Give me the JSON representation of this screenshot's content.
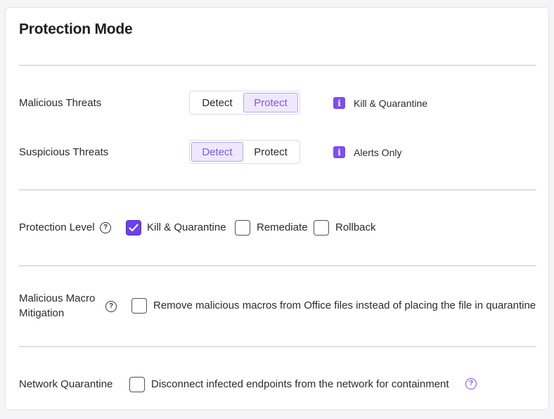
{
  "title": "Protection Mode",
  "threats": {
    "malicious": {
      "label": "Malicious Threats",
      "options": [
        "Detect",
        "Protect"
      ],
      "selected": "Protect",
      "info": "Kill & Quarantine"
    },
    "suspicious": {
      "label": "Suspicious Threats",
      "options": [
        "Detect",
        "Protect"
      ],
      "selected": "Detect",
      "info": "Alerts Only"
    }
  },
  "protection_level": {
    "label": "Protection Level",
    "options": [
      {
        "label": "Kill & Quarantine",
        "checked": true
      },
      {
        "label": "Remediate",
        "checked": false
      },
      {
        "label": "Rollback",
        "checked": false
      }
    ]
  },
  "macro": {
    "label_line1": "Malicious Macro",
    "label_line2": "Mitigation",
    "checkbox_label": "Remove malicious macros from Office files instead of placing the file in quarantine",
    "checked": false
  },
  "network": {
    "label": "Network Quarantine",
    "checkbox_label": "Disconnect infected endpoints from the network for containment",
    "checked": false
  },
  "icons": {
    "info": "info-icon",
    "help": "question-circle-icon",
    "check": "checkmark-icon"
  },
  "colors": {
    "accent": "#6d3ff0",
    "segment_active_bg": "#efe8fd",
    "segment_active_text": "#7b5be6"
  }
}
